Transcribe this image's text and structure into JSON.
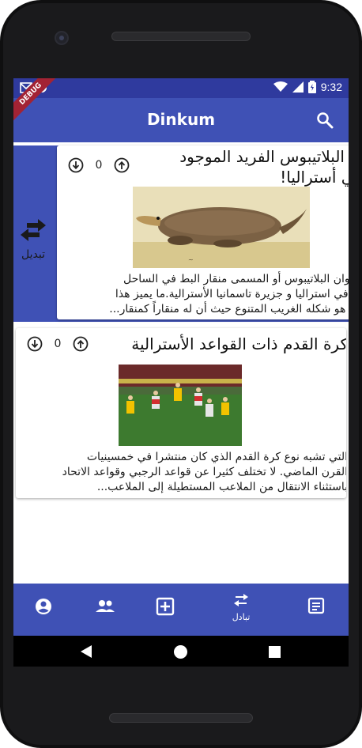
{
  "app": {
    "title": "Dinkum"
  },
  "status_bar": {
    "time": "9:32",
    "debug_label": "DEBUG"
  },
  "swipe_action": {
    "label": "تبديل",
    "icon": "swap-horiz-icon"
  },
  "posts": [
    {
      "title": "ى البلاتيبوس الفريد الموجود",
      "title_line2": "في أستراليا!",
      "votes": "0",
      "description_lines": [
        "حيوان البلاتيبوس أو المسمى منقار البط في الساحل",
        "ي في استراليا و جزيرة تاسمانيا الأسترالية.ما يميز هذا",
        "ان هو شكله الغريب المتنوع حيث أن له منقاراً كمنقار..."
      ]
    },
    {
      "title": "كرة القدم ذات القواعد الأسترالية",
      "votes": "0",
      "description_lines": [
        "التي تشبه نوع كرة القدم الذي كان منتشرا في خمسينيات",
        "القرن الماضي. لا تختلف كثيرا عن قواعد الرجبي وقواعد الاتحاد",
        "باستثناء الانتقال من الملاعب المستطيلة إلى الملاعب..."
      ]
    }
  ],
  "bottom_nav": {
    "items": [
      {
        "icon": "account-circle-icon",
        "label": ""
      },
      {
        "icon": "group-icon",
        "label": ""
      },
      {
        "icon": "add-box-icon",
        "label": ""
      },
      {
        "icon": "swap-horiz-icon",
        "label": "تبادل"
      },
      {
        "icon": "article-icon",
        "label": ""
      }
    ]
  },
  "colors": {
    "primary": "#3f51b5",
    "status_bar": "#2f3a9e",
    "debug_ribbon": "#a32334"
  }
}
